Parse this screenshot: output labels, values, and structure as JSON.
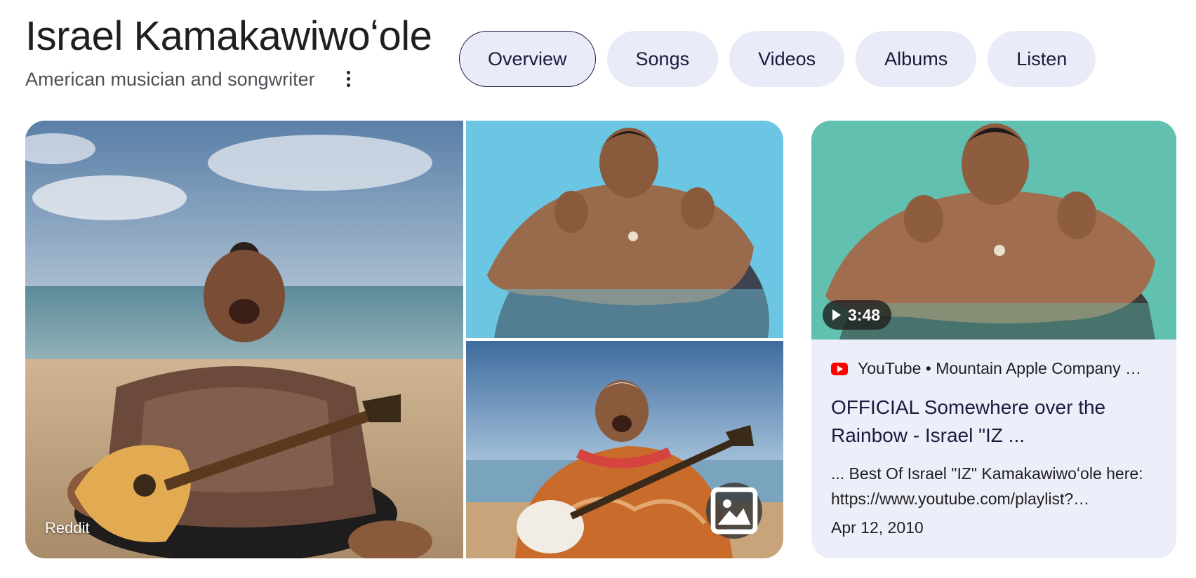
{
  "header": {
    "title": "Israel Kamakawiwoʻole",
    "subtitle": "American musician and songwriter",
    "more_icon": "more-vert-icon"
  },
  "tabs": [
    {
      "label": "Overview",
      "active": true
    },
    {
      "label": "Songs",
      "active": false
    },
    {
      "label": "Videos",
      "active": false
    },
    {
      "label": "Albums",
      "active": false
    },
    {
      "label": "Listen",
      "active": false
    }
  ],
  "gallery": {
    "main_image_source": "Reddit",
    "image_button_icon": "image-icon"
  },
  "video": {
    "duration": "3:48",
    "source": "YouTube • Mountain Apple Company …",
    "title": "OFFICIAL Somewhere over the Rainbow - Israel \"IZ ...",
    "description": "... Best Of Israel \"IZ\" Kamakawiwoʻole here: https://www.youtube.com/playlist?…",
    "date": "Apr 12, 2010"
  },
  "colors": {
    "tab_bg": "#e9ebf8",
    "tab_text": "#1a1c3d",
    "card_bg": "#eceef9",
    "youtube_red": "#ff0000"
  }
}
